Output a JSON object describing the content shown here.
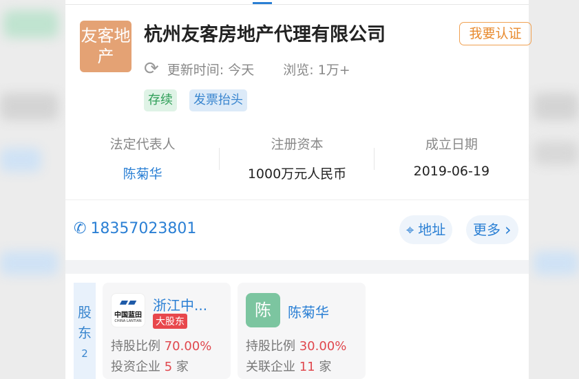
{
  "company": {
    "logo_text": "友客地产",
    "name": "杭州友客房地产代理有限公司",
    "certify_label": "我要认证",
    "update_label": "更新时间: 今天",
    "views_label": "浏览: 1万+",
    "tags": [
      "存续",
      "发票抬头"
    ]
  },
  "stats": [
    {
      "label": "法定代表人",
      "value": "陈菊华"
    },
    {
      "label": "注册资本",
      "value": "1000万元人民币"
    },
    {
      "label": "成立日期",
      "value": "2019-06-19"
    }
  ],
  "contact": {
    "phone": "18357023801",
    "address_label": "地址",
    "more_label": "更多"
  },
  "shareholders": {
    "label": "股东",
    "count": "2",
    "items": [
      {
        "name": "浙江中...",
        "logo_text": "中国蓝田",
        "logo_sub": "CHINA LANTIAN",
        "badge": "大股东",
        "ratio_label": "持股比例",
        "ratio": "70.00%",
        "rel_label": "投资企业",
        "rel_count": "5",
        "rel_unit": "家"
      },
      {
        "name": "陈菊华",
        "avatar": "陈",
        "ratio_label": "持股比例",
        "ratio": "30.00%",
        "rel_label": "关联企业",
        "rel_count": "11",
        "rel_unit": "家"
      }
    ]
  },
  "colors": {
    "accent": "#2a7fd4",
    "logo_bg": "#e4a274",
    "avatar_bg": "#7cc5a0",
    "red": "#e0484e"
  }
}
